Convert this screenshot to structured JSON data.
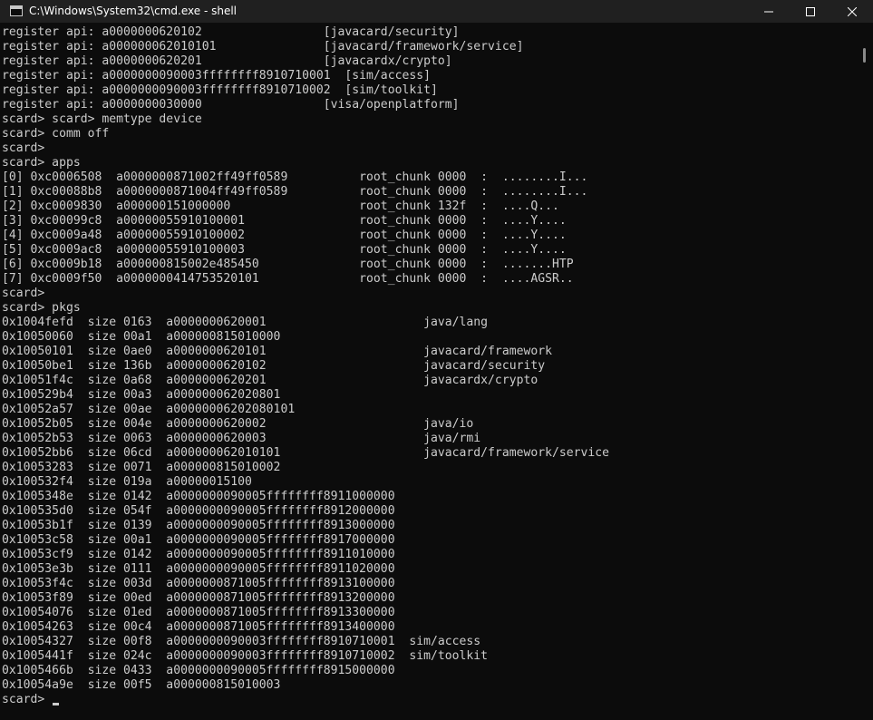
{
  "window": {
    "title": "C:\\Windows\\System32\\cmd.exe - shell",
    "icons": {
      "app": "cmd-icon",
      "minimize": "minimize-icon",
      "maximize": "maximize-icon",
      "close": "close-icon"
    },
    "colors": {
      "title_bar": "#202020",
      "console_bg": "#0c0c0c",
      "console_fg": "#cccccc"
    }
  },
  "console": {
    "lines": [
      "register api: a0000000620102                 [javacard/security]",
      "register api: a000000062010101               [javacard/framework/service]",
      "register api: a0000000620201                 [javacardx/crypto]",
      "register api: a0000000090003ffffffff8910710001  [sim/access]",
      "register api: a0000000090003ffffffff8910710002  [sim/toolkit]",
      "register api: a0000000030000                 [visa/openplatform]",
      "scard> scard> memtype device",
      "scard> comm off",
      "scard>",
      "scard> apps",
      "[0] 0xc0006508  a0000000871002ff49ff0589          root_chunk 0000  :  ........I...",
      "[1] 0xc00088b8  a0000000871004ff49ff0589          root_chunk 0000  :  ........I...",
      "[2] 0xc0009830  a000000151000000                  root_chunk 132f  :  ....Q...",
      "[3] 0xc00099c8  a00000055910100001                root_chunk 0000  :  ....Y....",
      "[4] 0xc0009a48  a00000055910100002                root_chunk 0000  :  ....Y....",
      "[5] 0xc0009ac8  a00000055910100003                root_chunk 0000  :  ....Y....",
      "[6] 0xc0009b18  a000000815002e485450              root_chunk 0000  :  .......HTP",
      "[7] 0xc0009f50  a0000000414753520101              root_chunk 0000  :  ....AGSR..",
      "scard>",
      "scard> pkgs",
      "0x1004fefd  size 0163  a0000000620001                      java/lang",
      "0x10050060  size 00a1  a000000815010000",
      "0x10050101  size 0ae0  a0000000620101                      javacard/framework",
      "0x10050be1  size 136b  a0000000620102                      javacard/security",
      "0x10051f4c  size 0a68  a0000000620201                      javacardx/crypto",
      "0x100529b4  size 00a3  a000000062020801",
      "0x10052a57  size 00ae  a00000006202080101",
      "0x10052b05  size 004e  a0000000620002                      java/io",
      "0x10052b53  size 0063  a0000000620003                      java/rmi",
      "0x10052bb6  size 06cd  a000000062010101                    javacard/framework/service",
      "0x10053283  size 0071  a000000815010002",
      "0x100532f4  size 019a  a00000015100",
      "0x1005348e  size 0142  a0000000090005ffffffff8911000000",
      "0x100535d0  size 054f  a0000000090005ffffffff8912000000",
      "0x10053b1f  size 0139  a0000000090005ffffffff8913000000",
      "0x10053c58  size 00a1  a0000000090005ffffffff8917000000",
      "0x10053cf9  size 0142  a0000000090005ffffffff8911010000",
      "0x10053e3b  size 0111  a0000000090005ffffffff8911020000",
      "0x10053f4c  size 003d  a0000000871005ffffffff8913100000",
      "0x10053f89  size 00ed  a0000000871005ffffffff8913200000",
      "0x10054076  size 01ed  a0000000871005ffffffff8913300000",
      "0x10054263  size 00c4  a0000000871005ffffffff8913400000",
      "0x10054327  size 00f8  a0000000090003ffffffff8910710001  sim/access",
      "0x1005441f  size 024c  a0000000090003ffffffff8910710002  sim/toolkit",
      "0x1005466b  size 0433  a0000000090005ffffffff8915000000",
      "0x10054a9e  size 00f5  a000000815010003"
    ],
    "prompt": "scard> "
  }
}
